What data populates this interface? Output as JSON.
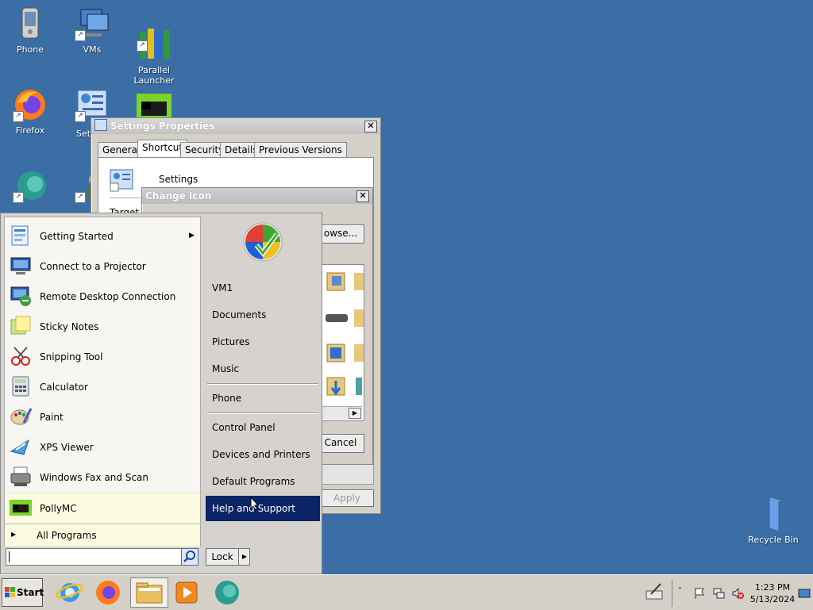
{
  "desktop": {
    "icons": [
      {
        "label": "Phone"
      },
      {
        "label": "VMs"
      },
      {
        "label": "Parallel\nLauncher"
      },
      {
        "label": "Firefox"
      },
      {
        "label": "Set"
      },
      {
        "label": "Recycle Bin"
      }
    ]
  },
  "settings_window": {
    "title": "Settings Properties",
    "tabs": [
      "General",
      "Shortcut",
      "Security",
      "Details",
      "Previous Versions"
    ],
    "active_tab": "Shortcut",
    "shortcut_name": "Settings",
    "target_label_partial": "Target t",
    "apply_label": "Apply"
  },
  "change_icon_dialog": {
    "title": "Change Icon",
    "browse_label": "owse...",
    "cancel_label": "Cancel"
  },
  "start_menu": {
    "left_items": [
      {
        "label": "Getting Started",
        "has_submenu": true
      },
      {
        "label": "Connect to a Projector"
      },
      {
        "label": "Remote Desktop Connection"
      },
      {
        "label": "Sticky Notes"
      },
      {
        "label": "Snipping Tool"
      },
      {
        "label": "Calculator"
      },
      {
        "label": "Paint"
      },
      {
        "label": "XPS Viewer"
      },
      {
        "label": "Windows Fax and Scan"
      },
      {
        "label": "PollyMC",
        "highlighted": true
      }
    ],
    "all_programs": "All Programs",
    "search_placeholder": "",
    "right_items": [
      {
        "label": "VM1"
      },
      {
        "label": "Documents"
      },
      {
        "label": "Pictures"
      },
      {
        "label": "Music"
      },
      {
        "label": "Phone"
      },
      {
        "label": "Control Panel"
      },
      {
        "label": "Devices and Printers"
      },
      {
        "label": "Default Programs"
      },
      {
        "label": "Help and Support",
        "selected": true
      }
    ],
    "lock_label": "Lock"
  },
  "taskbar": {
    "start_label": "Start",
    "clock_time": "1:23 PM",
    "clock_date": "5/13/2024"
  },
  "colors": {
    "desktop": "#3a6ea5",
    "selection": "#0b2465",
    "highlight": "#fbfbe0"
  }
}
